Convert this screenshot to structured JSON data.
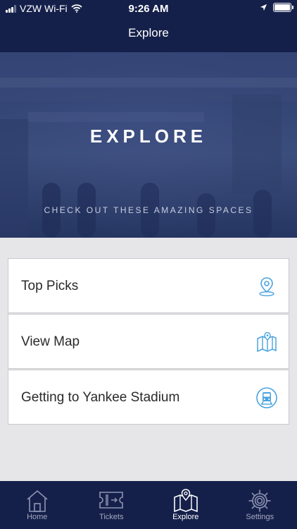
{
  "status_bar": {
    "carrier": "VZW Wi-Fi",
    "time": "9:26 AM"
  },
  "nav": {
    "title": "Explore"
  },
  "hero": {
    "title": "EXPLORE",
    "subtitle": "CHECK OUT THESE AMAZING SPACES"
  },
  "list": {
    "items": [
      {
        "label": "Top Picks",
        "icon": "map-pin-icon"
      },
      {
        "label": "View Map",
        "icon": "folded-map-icon"
      },
      {
        "label": "Getting to Yankee Stadium",
        "icon": "train-icon"
      }
    ]
  },
  "tabbar": {
    "tabs": [
      {
        "label": "Home",
        "icon": "home-icon",
        "active": false
      },
      {
        "label": "Tickets",
        "icon": "ticket-icon",
        "active": false
      },
      {
        "label": "Explore",
        "icon": "map-icon",
        "active": true
      },
      {
        "label": "Settings",
        "icon": "gear-icon",
        "active": false
      }
    ]
  },
  "colors": {
    "nav_background": "#15204a",
    "accent_icon": "#4aa3df",
    "list_background": "#e6e6e8"
  }
}
